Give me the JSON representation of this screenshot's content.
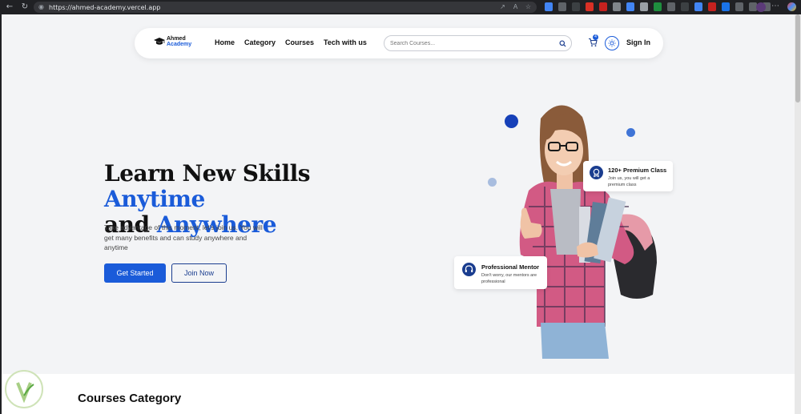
{
  "browser": {
    "url": "https://ahmed-academy.vercel.app"
  },
  "navbar": {
    "logo_line1": "Ahmed",
    "logo_line2": "Academy",
    "menu": [
      "Home",
      "Category",
      "Courses",
      "Tech with us"
    ],
    "search_placeholder": "Search Courses...",
    "cart_count": "4",
    "signin_label": "Sign In"
  },
  "hero": {
    "title_part1": "Learn New Skills ",
    "title_highlight1": "Anytime",
    "title_part2": "and ",
    "title_highlight2": "Anywhere",
    "subtitle": "Take advantage of this moment, let's join us. You will get many benefits and can study anywhere and anytime",
    "primary_button": "Get Started",
    "secondary_button": "Join Now"
  },
  "cards": {
    "premium": {
      "title": "120+ Premium Class",
      "desc": "Join us, you will get a premium class"
    },
    "mentor": {
      "title": "Professional Mentor",
      "desc": "Don't worry, our mentors are professional"
    }
  },
  "section": {
    "heading": "Courses Category"
  },
  "colors": {
    "accent": "#1a5bd9",
    "navy": "#1a3d8f",
    "page_bg": "#f3f4f6"
  }
}
